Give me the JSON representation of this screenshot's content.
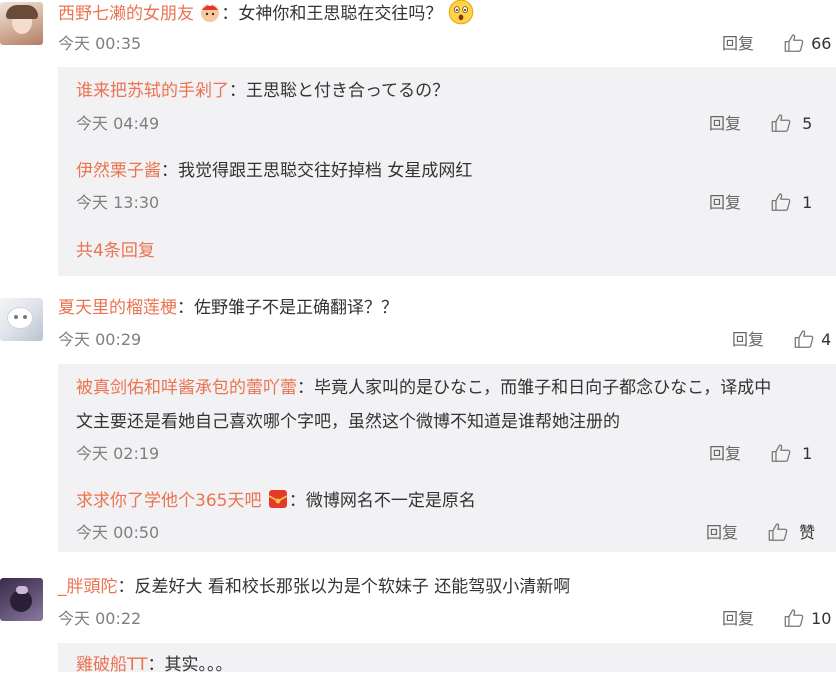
{
  "colors": {
    "username": "#eb7350",
    "reply_bg": "#f2f2f5",
    "meta": "#808080"
  },
  "comments": [
    {
      "user": "西野七濑的女朋友",
      "sep": "：",
      "text": "女神你和王思聪在交往吗？",
      "time": "今天 00:35",
      "reply_label": "回复",
      "likes": "66",
      "replies": [
        {
          "user": "谁来把苏轼的手剁了",
          "sep": "：",
          "text": "王思聡と付き合ってるの？",
          "time": "今天 04:49",
          "reply_label": "回复",
          "likes": "5"
        },
        {
          "user": "伊然栗子酱",
          "sep": "：",
          "text": "我觉得跟王思聪交往好掉档 女星成网红",
          "time": "今天 13:30",
          "reply_label": "回复",
          "likes": "1"
        }
      ],
      "more_replies": "共4条回复"
    },
    {
      "user": "夏天里的榴莲梗",
      "sep": "：",
      "text": "佐野雏子不是正确翻译？？",
      "time": "今天 00:29",
      "reply_label": "回复",
      "likes": "4",
      "replies": [
        {
          "user": "被真剑佑和咩酱承包的蕾吖蕾",
          "sep": "：",
          "text_line1": "毕竟人家叫的是ひなこ，而雏子和日向子都念ひなこ，译成中",
          "text_line2": "文主要还是看她自己喜欢哪个字吧，虽然这个微博不知道是谁帮她注册的",
          "time": "今天 02:19",
          "reply_label": "回复",
          "likes": "1"
        },
        {
          "user": "求求你了学他个365天吧",
          "sep": "：",
          "text": "微博网名不一定是原名",
          "time": "今天 00:50",
          "reply_label": "回复",
          "likes": "赞"
        }
      ]
    },
    {
      "user": "_胖頭陀",
      "sep": "：",
      "text": "反差好大 看和校长那张以为是个软妹子 还能驾驭小清新啊",
      "time": "今天 00:22",
      "reply_label": "回复",
      "likes": "10",
      "replies": [
        {
          "user": "雞破船TT",
          "sep": "：",
          "text": "其实。。。"
        }
      ]
    }
  ],
  "icons": {
    "badge_hat": "red-hat-badge-icon",
    "shocked_emoji": "shocked-face-emoji-icon",
    "red_envelope": "red-envelope-badge-icon",
    "like": "thumbs-up-icon"
  }
}
